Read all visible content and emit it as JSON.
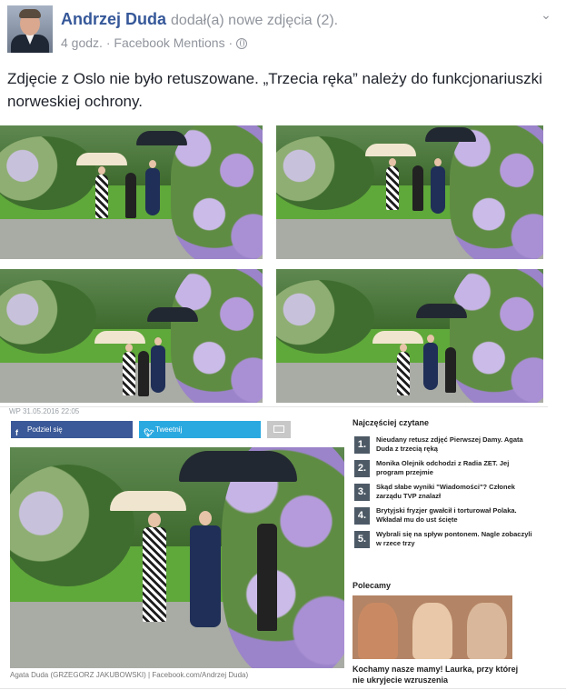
{
  "post": {
    "author": "Andrzej Duda",
    "action": "dodał(a) nowe zdjęcia (2).",
    "time": "4 godz.",
    "separator": "·",
    "source": "Facebook Mentions",
    "text": "Zdjęcie z Oslo nie było retuszowane. „Trzecia ręka” należy do funkcjonariuszki norweskiej ochrony."
  },
  "article": {
    "meta": "WP  31.05.2016 22:05",
    "share_facebook": "Podziel się",
    "share_twitter": "Tweetnij",
    "caption": "Agata Duda (GRZEGORZ JAKUBOWSKI) | Facebook.com/Andrzej Duda)",
    "sidebar": {
      "title": "Najczęściej czytane",
      "items": [
        {
          "num": "1.",
          "text": "Nieudany retusz zdjęć Pierwszej Damy. Agata Duda z trzecią ręką"
        },
        {
          "num": "2.",
          "text": "Monika Olejnik odchodzi z Radia ZET. Jej program przejmie"
        },
        {
          "num": "3.",
          "text": "Skąd słabe wyniki \"Wiadomości\"? Członek zarządu TVP znalazł"
        },
        {
          "num": "4.",
          "text": "Brytyjski fryzjer gwałcił i torturował Polaka. Wkładał mu do ust ścięte"
        },
        {
          "num": "5.",
          "text": "Wybrali się na spływ pontonem. Nagle zobaczyli w rzece trzy"
        }
      ],
      "polecamy_title": "Polecamy",
      "polecamy_caption": "Kochamy nasze mamy! Laurka, przy której nie ukryjecie wzruszenia"
    }
  },
  "icons": {
    "globe": "globe-icon",
    "chevron": "chevron-down-icon",
    "facebook": "facebook-icon",
    "twitter": "twitter-icon",
    "mail": "mail-icon"
  },
  "colors": {
    "author_link": "#365899",
    "meta_gray": "#90949c",
    "facebook_blue": "#3b5998",
    "twitter_blue": "#2aa9e0"
  }
}
